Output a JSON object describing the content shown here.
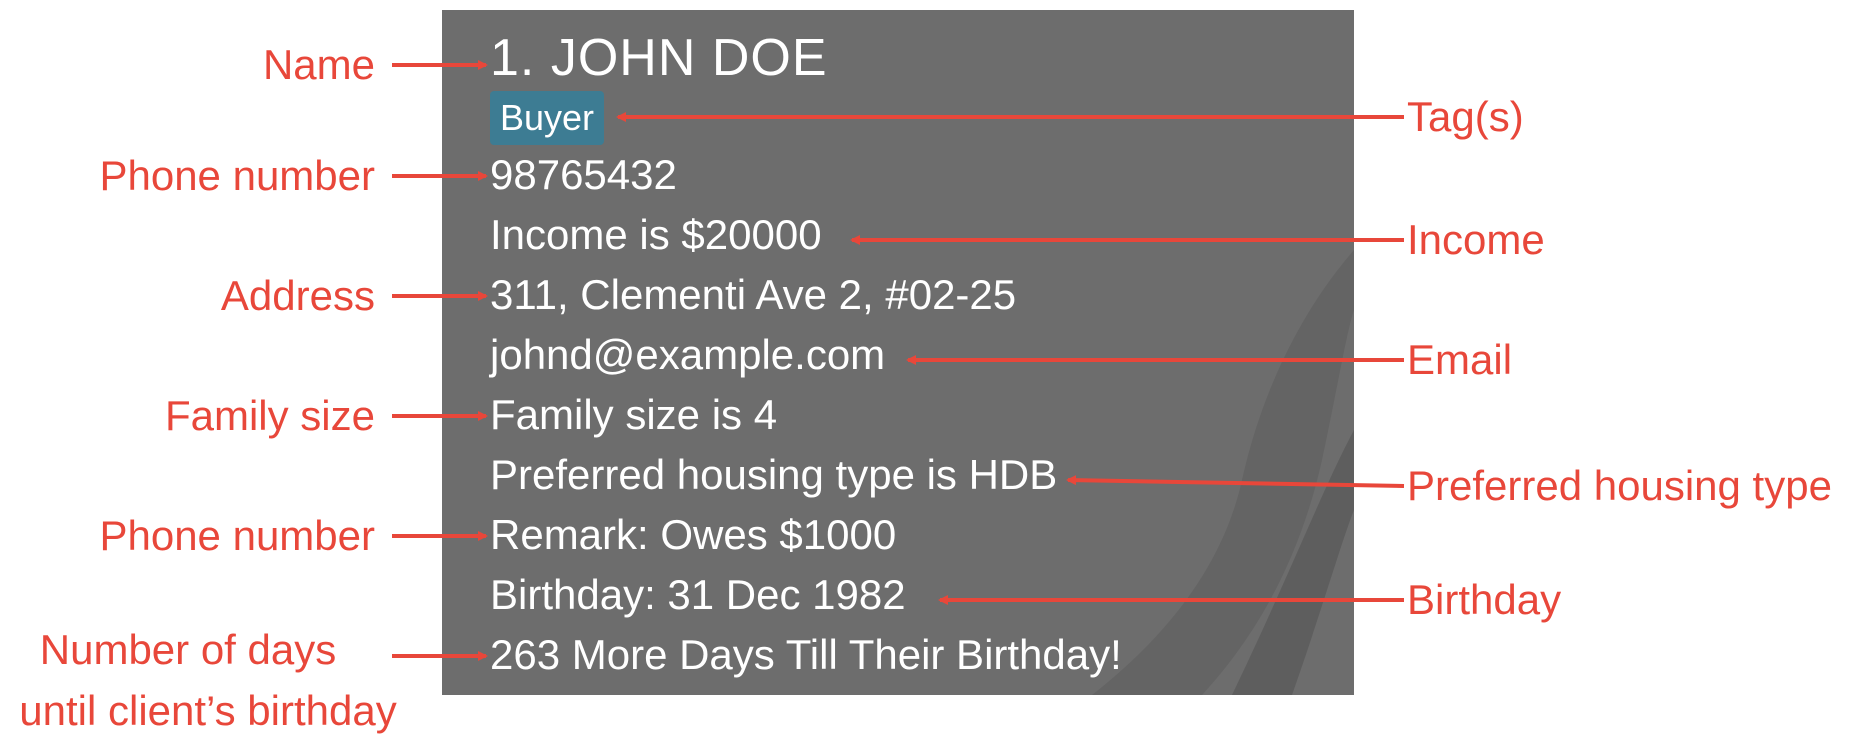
{
  "card": {
    "title": "1.  JOHN DOE",
    "tag": "Buyer",
    "phone": "98765432",
    "income": "Income is $20000",
    "address": "311, Clementi Ave 2, #02-25",
    "email": "johnd@example.com",
    "family_size": "Family size is 4",
    "housing": "Preferred housing type is HDB",
    "remark": "Remark: Owes $1000",
    "birthday": "Birthday: 31 Dec 1982",
    "days_until": "263 More Days Till Their Birthday!"
  },
  "labels": {
    "left": {
      "name": "Name",
      "phone": "Phone number",
      "address": "Address",
      "family_size": "Family size",
      "remark": "Phone number",
      "days_line1": "Number of days",
      "days_line2": "until client’s birthday"
    },
    "right": {
      "tags": "Tag(s)",
      "income": "Income",
      "email": "Email",
      "housing": "Preferred housing type",
      "birthday": "Birthday"
    }
  },
  "colors": {
    "card_background": "#6d6d6d",
    "tag_background": "#3d7c93",
    "annotation": "#e8473a",
    "card_text": "#ffffff"
  }
}
